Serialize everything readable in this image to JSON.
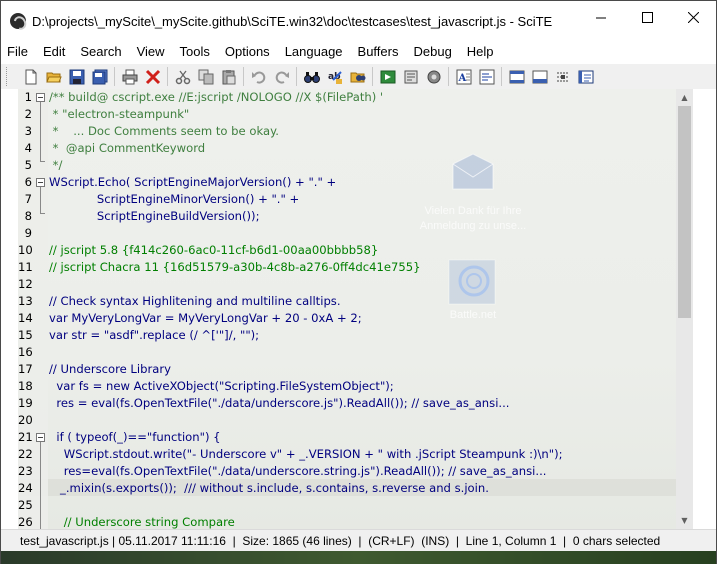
{
  "window": {
    "title": "D:\\projects\\_myScite\\_myScite.github\\SciTE.win32\\doc\\testcases\\test_javascript.js - SciTE",
    "minimize": "—",
    "maximize": "☐",
    "close": "✕"
  },
  "menu": [
    "File",
    "Edit",
    "Search",
    "View",
    "Tools",
    "Options",
    "Language",
    "Buffers",
    "Debug",
    "Help"
  ],
  "toolbar": {
    "groups": [
      [
        "new-file-icon",
        "open-folder-icon",
        "save-icon",
        "save-all-icon"
      ],
      [
        "print-icon",
        "close-red-x-icon"
      ],
      [
        "cut-icon",
        "copy-icon",
        "paste-icon"
      ],
      [
        "undo-icon",
        "redo-icon"
      ],
      [
        "find-icon",
        "find-replace-icon",
        "find-in-files-icon"
      ],
      [
        "go-icon",
        "compile-icon",
        "build-icon"
      ],
      [
        "fonts-icon",
        "tools-icon"
      ],
      [
        "toggle-panel-icon",
        "toggle-output-icon",
        "split-icon",
        "fullscreen-icon"
      ]
    ]
  },
  "editor": {
    "lines": [
      {
        "n": "1",
        "text": "/** build@ cscript.exe //E:jscript /NOLOGO //X $(FilePath) '"
      },
      {
        "n": "2",
        "text": " * \"electron-steampunk\""
      },
      {
        "n": "3",
        "text": " *    ... Doc Comments seem to be okay."
      },
      {
        "n": "4",
        "text": " *  @api CommentKeyword"
      },
      {
        "n": "5",
        "text": " */"
      },
      {
        "n": "6",
        "text": "WScript.Echo( ScriptEngineMajorVersion() + \".\" +"
      },
      {
        "n": "7",
        "text": "             ScriptEngineMinorVersion() + \".\" +"
      },
      {
        "n": "8",
        "text": "             ScriptEngineBuildVersion());"
      },
      {
        "n": "9",
        "text": ""
      },
      {
        "n": "10",
        "text": "// jscript 5.8 {f414c260-6ac0-11cf-b6d1-00aa00bbbb58}"
      },
      {
        "n": "11",
        "text": "// jscript Chacra 11 {16d51579-a30b-4c8b-a276-0ff4dc41e755}"
      },
      {
        "n": "12",
        "text": ""
      },
      {
        "n": "13",
        "text": "// Check syntax Highlitening and multiline calltips."
      },
      {
        "n": "14",
        "text": "var MyVeryLongVar = MyVeryLongVar + 20 - 0xA + 2;"
      },
      {
        "n": "15",
        "text": "var str = \"asdf\".replace (/ ^['\"]/, \"\");"
      },
      {
        "n": "16",
        "text": ""
      },
      {
        "n": "17",
        "text": "// Underscore Library"
      },
      {
        "n": "18",
        "text": "  var fs = new ActiveXObject(\"Scripting.FileSystemObject\");"
      },
      {
        "n": "19",
        "text": "  res = eval(fs.OpenTextFile(\"./data/underscore.js\").ReadAll()); // save_as_ansi..."
      },
      {
        "n": "20",
        "text": ""
      },
      {
        "n": "21",
        "text": "  if ( typeof(_)==\"function\") {"
      },
      {
        "n": "22",
        "text": "    WScript.stdout.write(\"- Underscore v\" + _.VERSION + \" with .jScript Steampunk :)\\n\");"
      },
      {
        "n": "23",
        "text": "    res=eval(fs.OpenTextFile(\"./data/underscore.string.js\").ReadAll()); // save_as_ansi..."
      },
      {
        "n": "24",
        "text": "   _.mixin(s.exports());  /// without s.include, s.contains, s.reverse and s.join."
      },
      {
        "n": "25",
        "text": ""
      },
      {
        "n": "26",
        "text": "    // Underscore string Compare"
      }
    ]
  },
  "desktop": {
    "mail_caption_1": "Vielen Dank für Ihre",
    "mail_caption_2": "Anmeldung zu unse...",
    "battlenet_caption": "Battle.net"
  },
  "statusbar": {
    "text": "test_javascript.js | 05.11.2017 11:11:16  |  Size: 1865 (46 lines)  |  (CR+LF)  (INS)  |  Line 1, Column 1  |  0 chars selected"
  },
  "colors": {
    "comment": "#007f00",
    "keyword": "#00007f",
    "string": "#7f007f",
    "number": "#007f7f"
  }
}
